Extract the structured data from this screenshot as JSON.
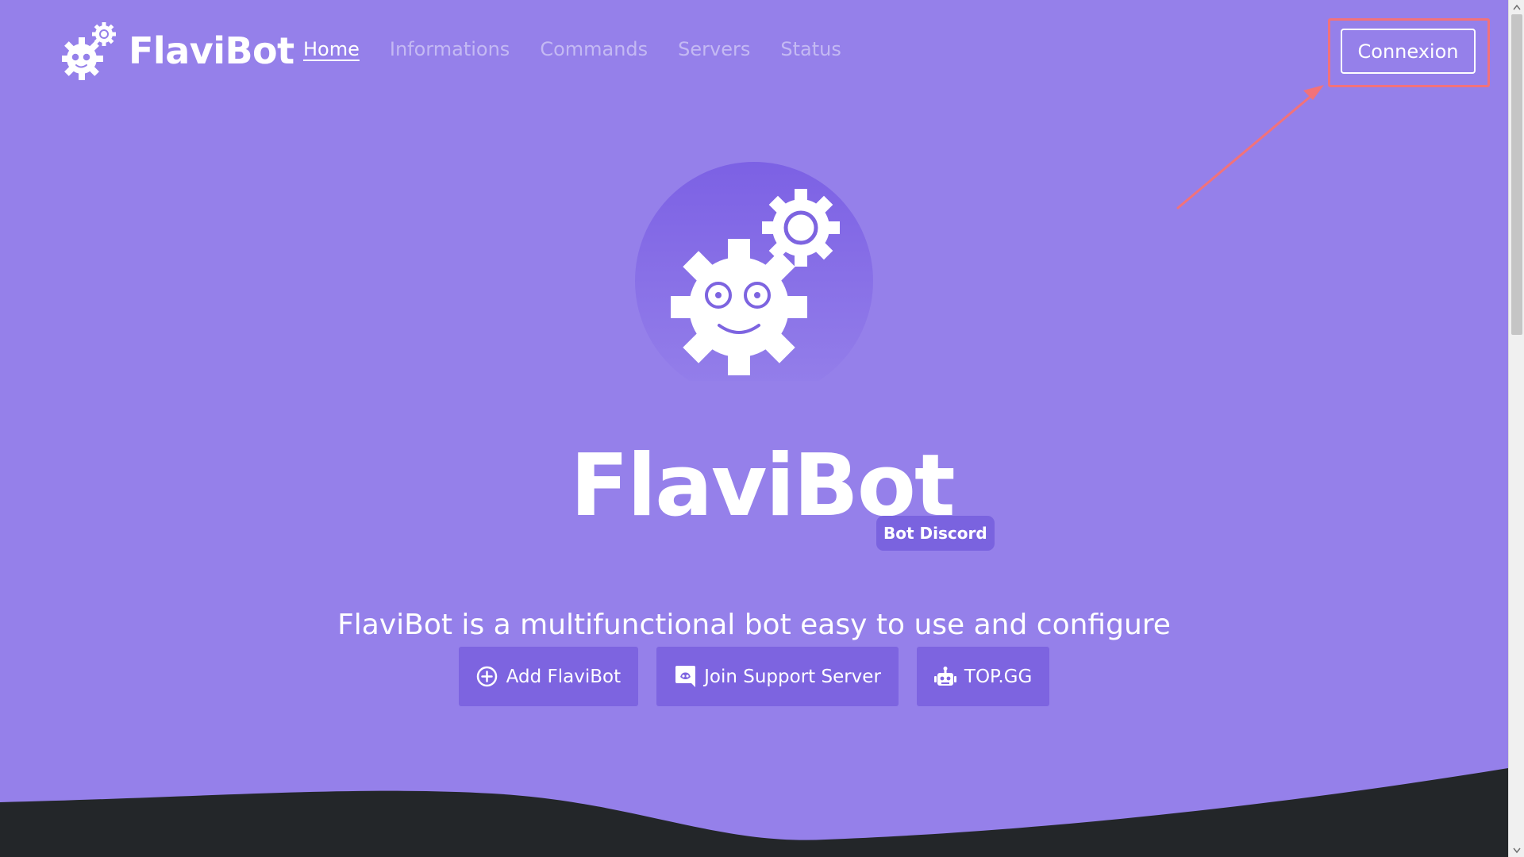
{
  "colors": {
    "background": "#9580ea",
    "button": "#7d64e0",
    "text": "#ffffff",
    "muted_nav": "#c4b9f3",
    "highlight": "#f2727a",
    "footer": "#232629"
  },
  "brand": {
    "name": "FlaviBot",
    "logo_icon": "gear-robot-icon"
  },
  "nav": {
    "items": [
      {
        "label": "Home",
        "active": true
      },
      {
        "label": "Informations",
        "active": false
      },
      {
        "label": "Commands",
        "active": false
      },
      {
        "label": "Servers",
        "active": false
      },
      {
        "label": "Status",
        "active": false
      }
    ],
    "login_label": "Connexion"
  },
  "hero": {
    "title": "FlaviBot",
    "badge": "Bot Discord",
    "tagline": "FlaviBot is a multifunctional bot easy to use and configure",
    "buttons": [
      {
        "label": "Add FlaviBot",
        "icon": "plus-circle-icon"
      },
      {
        "label": "Join Support Server",
        "icon": "discord-icon"
      },
      {
        "label": "TOP.GG",
        "icon": "robot-icon"
      }
    ]
  }
}
